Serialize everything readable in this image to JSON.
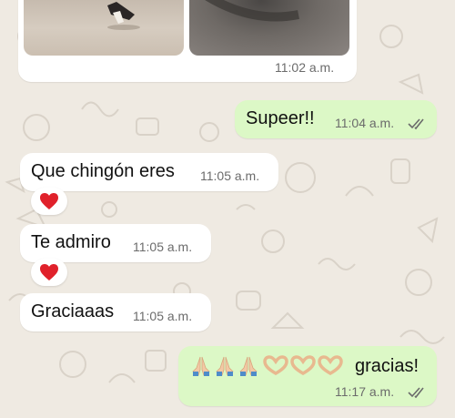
{
  "colors": {
    "background": "#efeae2",
    "incoming_bubble": "#ffffff",
    "outgoing_bubble": "#dcf8c6",
    "timestamp": "#6b6b6b",
    "read_ticks": "#6b6b6b",
    "reaction_heart": "#e0212b"
  },
  "photo_message": {
    "time": "11:02 a.m.",
    "photos": [
      "photo-left",
      "photo-right"
    ]
  },
  "messages": [
    {
      "direction": "out",
      "text": "Supeer!!",
      "time": "11:04 a.m.",
      "status": "read"
    },
    {
      "direction": "in",
      "text": "Que chingón eres",
      "time": "11:05 a.m.",
      "reaction": "red-heart-icon"
    },
    {
      "direction": "in",
      "text": "Te admiro",
      "time": "11:05 a.m.",
      "reaction": "red-heart-icon"
    },
    {
      "direction": "in",
      "text": "Graciaaas",
      "time": "11:05 a.m."
    },
    {
      "direction": "out",
      "emoji": [
        "folded-hands-icon",
        "folded-hands-icon",
        "folded-hands-icon",
        "heart-hands-icon",
        "heart-hands-icon",
        "heart-hands-icon"
      ],
      "text": "gracias!",
      "time": "11:17 a.m.",
      "status": "read"
    }
  ]
}
